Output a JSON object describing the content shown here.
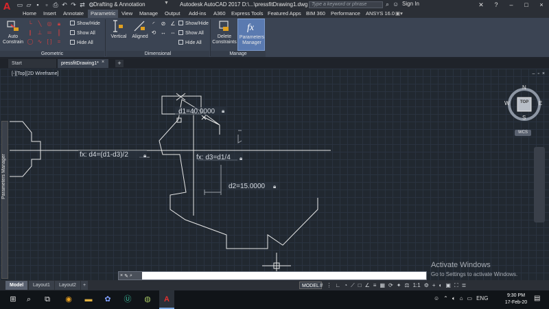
{
  "title_bar": {
    "workspace": "Drafting & Annotation",
    "document_title": "Autodesk AutoCAD 2017    D:\\...\\pressfitDrawing1.dwg",
    "search_placeholder": "Type a keyword or phrase",
    "sign_in": "Sign In"
  },
  "ribbon_tabs": [
    "Home",
    "Insert",
    "Annotate",
    "Parametric",
    "View",
    "Manage",
    "Output",
    "Add-ins",
    "A360",
    "Express Tools",
    "Featured Apps",
    "BIM 360",
    "Performance",
    "ANSYS 16.0"
  ],
  "active_ribbon_tab": "Parametric",
  "ribbon": {
    "auto_constrain": "Auto Constrain",
    "geometric_panel": "Geometric",
    "geo_show_hide": "Show/Hide",
    "geo_show_all": "Show All",
    "geo_hide_all": "Hide All",
    "vertical": "Vertical",
    "aligned": "Aligned",
    "dimensional_panel": "Dimensional",
    "dim_show_hide": "Show/Hide",
    "dim_show_all": "Show All",
    "dim_hide_all": "Hide All",
    "delete_constraints": "Delete Constraints",
    "parameters_manager": "Parameters Manager",
    "manage_panel": "Manage"
  },
  "file_tabs": {
    "start": "Start",
    "document": "pressfitDrawing1*"
  },
  "viewport": {
    "view_label": "[-][Top][2D Wireframe]",
    "parameters_manager_side": "Parameters Manager",
    "viewcube": {
      "n": "N",
      "s": "S",
      "e": "E",
      "w": "W",
      "top": "TOP",
      "wcs": "WCS"
    }
  },
  "constraints": {
    "d1": "d1=40.0000",
    "d2": "d2=15.0000",
    "d3": "fx: d3=d1/4",
    "d4": "fx: d4=(d1-d3)/2"
  },
  "watermark": {
    "line1": "Activate Windows",
    "line2": "Go to Settings to activate Windows."
  },
  "command_line": {
    "prompt": ""
  },
  "layout_tabs": [
    "Model",
    "Layout1",
    "Layout2"
  ],
  "active_layout_tab": "Model",
  "status_bar": {
    "model": "MODEL",
    "scale": "1:1"
  },
  "taskbar": {
    "language": "ENG",
    "time": "9:30 PM",
    "date": "17-Feb-20"
  }
}
